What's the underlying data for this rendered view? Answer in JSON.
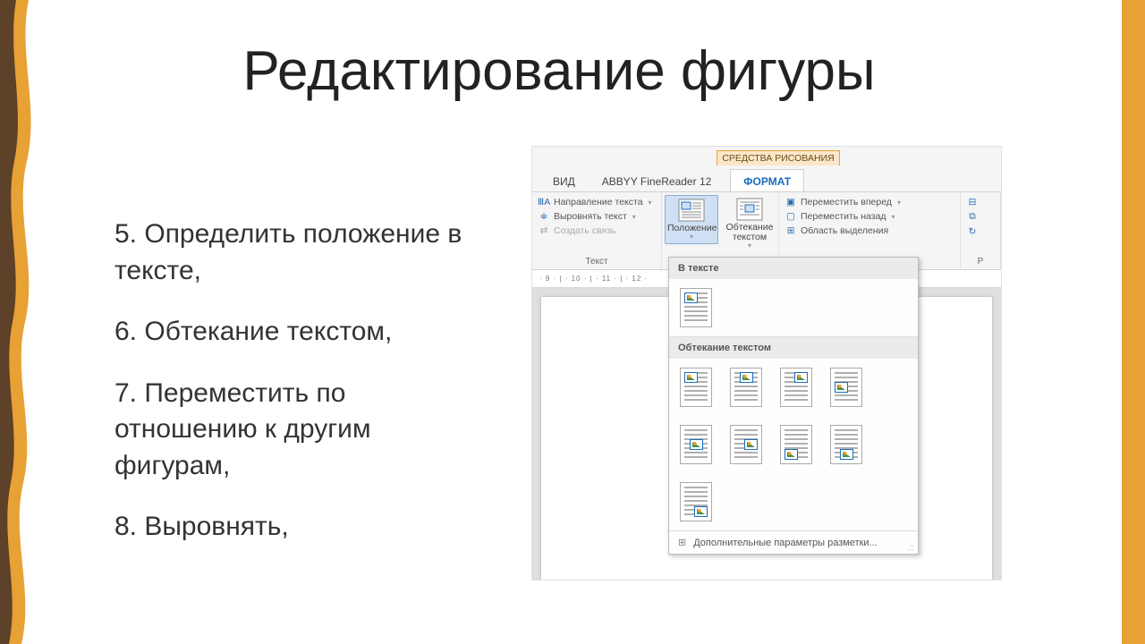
{
  "slide": {
    "title": "Редактирование фигуры",
    "bullets": [
      "5. Определить положение в тексте,",
      "6. Обтекание текстом,",
      "7. Переместить по отношению к другим фигурам,",
      "8. Выровнять,"
    ]
  },
  "word_ribbon": {
    "context_tab": "СРЕДСТВА РИСОВАНИЯ",
    "tabs": {
      "view": "ВИД",
      "abbyy": "ABBYY FineReader 12",
      "format": "ФОРМАТ"
    },
    "group_text": {
      "direction": "Направление текста",
      "align": "Выровнять текст",
      "link": "Создать связь",
      "label": "Текст"
    },
    "position": {
      "label": "Положение"
    },
    "wrap": {
      "label_line1": "Обтекание",
      "label_line2": "текстом"
    },
    "arrange": {
      "forward": "Переместить вперед",
      "backward": "Переместить назад",
      "selection_pane": "Область выделения"
    },
    "arrange_partial": "Р",
    "ruler": "· 9 · | · 10 · | · 11 · | · 12 ·"
  },
  "dropdown": {
    "section1": "В тексте",
    "section2": "Обтекание текстом",
    "footer": "Дополнительные параметры разметки...",
    "resize": ".::"
  }
}
